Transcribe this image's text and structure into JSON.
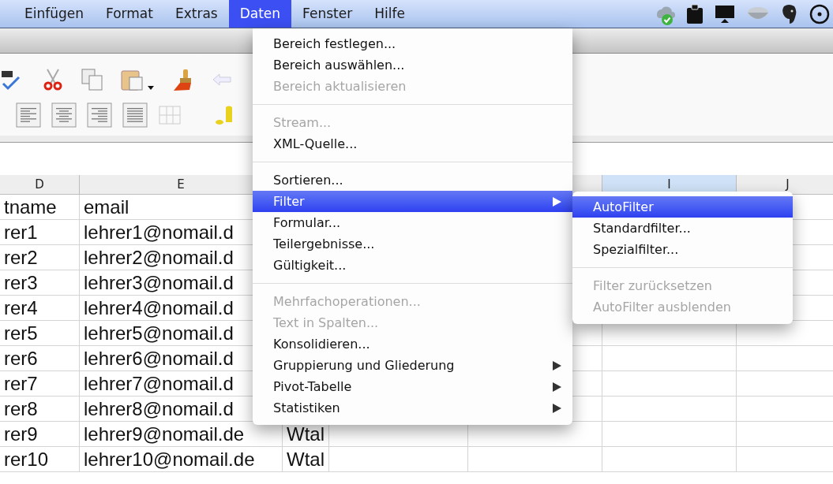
{
  "menu_bar": {
    "items": [
      {
        "label": "Einfügen",
        "selected": false
      },
      {
        "label": "Format",
        "selected": false
      },
      {
        "label": "Extras",
        "selected": false
      },
      {
        "label": "Daten",
        "selected": true
      },
      {
        "label": "Fenster",
        "selected": false
      },
      {
        "label": "Hilfe",
        "selected": false
      }
    ]
  },
  "sheet": {
    "columns": [
      {
        "label": "D",
        "selected": false
      },
      {
        "label": "E",
        "selected": false
      },
      {
        "label": "I",
        "selected": true
      },
      {
        "label": "J",
        "selected": false
      }
    ],
    "rows": [
      {
        "cells": [
          "tname",
          "email"
        ]
      },
      {
        "cells": [
          "rer1",
          "lehrer1@nomail.d"
        ]
      },
      {
        "cells": [
          "rer2",
          "lehrer2@nomail.d"
        ]
      },
      {
        "cells": [
          "rer3",
          "lehrer3@nomail.d"
        ]
      },
      {
        "cells": [
          "rer4",
          "lehrer4@nomail.d"
        ]
      },
      {
        "cells": [
          "rer5",
          "lehrer5@nomail.d"
        ]
      },
      {
        "cells": [
          "rer6",
          "lehrer6@nomail.d"
        ]
      },
      {
        "cells": [
          "rer7",
          "lehrer7@nomail.d"
        ]
      },
      {
        "cells": [
          "rer8",
          "lehrer8@nomail.d"
        ]
      },
      {
        "cells": [
          "rer9",
          "lehrer9@nomail.de",
          "Wtal"
        ]
      },
      {
        "cells": [
          "rer10",
          "lehrer10@nomail.de",
          "Wtal"
        ]
      }
    ]
  },
  "menu": {
    "items": [
      {
        "kind": "item",
        "label": "Bereich festlegen...",
        "disabled": false,
        "selected": false,
        "submenu": false
      },
      {
        "kind": "item",
        "label": "Bereich auswählen...",
        "disabled": false,
        "selected": false,
        "submenu": false
      },
      {
        "kind": "item",
        "label": "Bereich aktualisieren",
        "disabled": true,
        "selected": false,
        "submenu": false
      },
      {
        "kind": "separator"
      },
      {
        "kind": "item",
        "label": "Stream...",
        "disabled": true,
        "selected": false,
        "submenu": false
      },
      {
        "kind": "item",
        "label": "XML-Quelle...",
        "disabled": false,
        "selected": false,
        "submenu": false
      },
      {
        "kind": "separator"
      },
      {
        "kind": "item",
        "label": "Sortieren...",
        "disabled": false,
        "selected": false,
        "submenu": false
      },
      {
        "kind": "item",
        "label": "Filter",
        "disabled": false,
        "selected": true,
        "submenu": true
      },
      {
        "kind": "item",
        "label": "Formular...",
        "disabled": false,
        "selected": false,
        "submenu": false
      },
      {
        "kind": "item",
        "label": "Teilergebnisse...",
        "disabled": false,
        "selected": false,
        "submenu": false
      },
      {
        "kind": "item",
        "label": "Gültigkeit...",
        "disabled": false,
        "selected": false,
        "submenu": false
      },
      {
        "kind": "separator"
      },
      {
        "kind": "item",
        "label": "Mehrfachoperationen...",
        "disabled": true,
        "selected": false,
        "submenu": false
      },
      {
        "kind": "item",
        "label": "Text in Spalten...",
        "disabled": true,
        "selected": false,
        "submenu": false
      },
      {
        "kind": "item",
        "label": "Konsolidieren...",
        "disabled": false,
        "selected": false,
        "submenu": false
      },
      {
        "kind": "item",
        "label": "Gruppierung und Gliederung",
        "disabled": false,
        "selected": false,
        "submenu": true
      },
      {
        "kind": "item",
        "label": "Pivot-Tabelle",
        "disabled": false,
        "selected": false,
        "submenu": true
      },
      {
        "kind": "item",
        "label": "Statistiken",
        "disabled": false,
        "selected": false,
        "submenu": true
      }
    ]
  },
  "submenu": {
    "items": [
      {
        "kind": "item",
        "label": "AutoFilter",
        "disabled": false,
        "selected": true
      },
      {
        "kind": "item",
        "label": "Standardfilter...",
        "disabled": false,
        "selected": false
      },
      {
        "kind": "item",
        "label": "Spezialfilter...",
        "disabled": false,
        "selected": false
      },
      {
        "kind": "separator"
      },
      {
        "kind": "item",
        "label": "Filter zurücksetzen",
        "disabled": true,
        "selected": false
      },
      {
        "kind": "item",
        "label": "AutoFilter ausblenden",
        "disabled": true,
        "selected": false
      }
    ]
  }
}
